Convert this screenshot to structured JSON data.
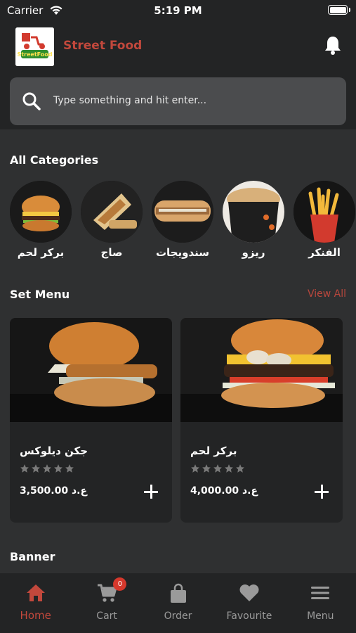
{
  "status_bar": {
    "carrier": "Carrier",
    "time": "5:19 PM"
  },
  "header": {
    "app_title": "Street Food",
    "logo_text": "StreetFood",
    "search_placeholder": "Type something and hit enter..."
  },
  "categories_section": {
    "title": "All Categories",
    "items": [
      {
        "label": "برکر لحم",
        "icon": "burger"
      },
      {
        "label": "صاج",
        "icon": "saj-wrap"
      },
      {
        "label": "سندويجات",
        "icon": "sandwich"
      },
      {
        "label": "ريزو",
        "icon": "rizo-box"
      },
      {
        "label": "الفنكر",
        "icon": "fries"
      }
    ]
  },
  "set_menu": {
    "title": "Set Menu",
    "view_all": "View All",
    "items": [
      {
        "name": "جكن ديلوكس",
        "price": "3,500.00 ع.د",
        "rating": 0,
        "max_rating": 5
      },
      {
        "name": "برکر لحم",
        "price": "4,000.00 ع.د",
        "rating": 0,
        "max_rating": 5
      }
    ]
  },
  "banner_section": {
    "title": "Banner"
  },
  "tab_bar": {
    "tabs": [
      {
        "label": "Home",
        "icon": "home-icon",
        "active": true
      },
      {
        "label": "Cart",
        "icon": "cart-icon",
        "badge": "0"
      },
      {
        "label": "Order",
        "icon": "bag-icon"
      },
      {
        "label": "Favourite",
        "icon": "heart-icon"
      },
      {
        "label": "Menu",
        "icon": "hamburger-menu-icon"
      }
    ]
  },
  "colors": {
    "accent": "#c2483c",
    "background": "#2f3031",
    "surface": "#232425",
    "star": "#7a7a7a"
  }
}
